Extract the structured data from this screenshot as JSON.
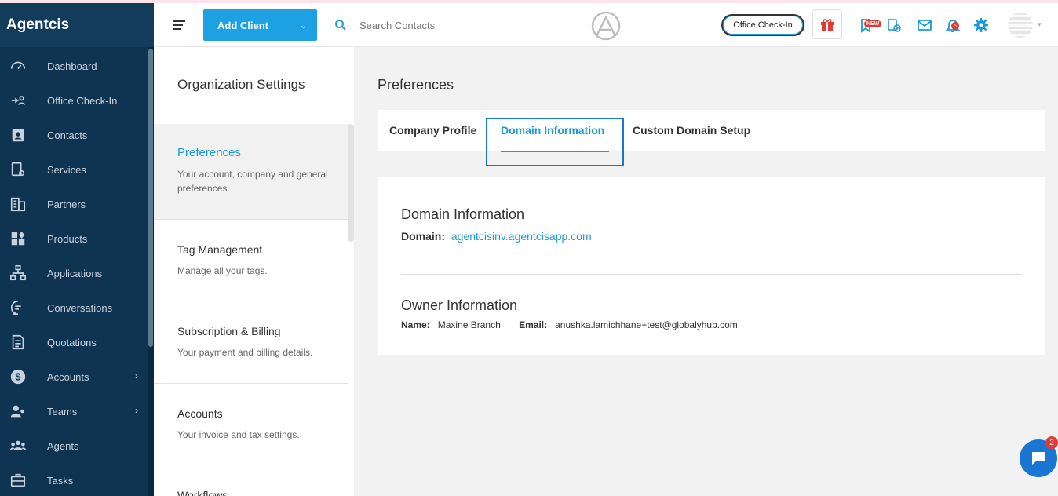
{
  "sidebar": {
    "brand": "Agentcis",
    "items": [
      {
        "label": "Dashboard",
        "icon": "dashboard-icon"
      },
      {
        "label": "Office Check-In",
        "icon": "office-checkin-icon"
      },
      {
        "label": "Contacts",
        "icon": "contacts-icon"
      },
      {
        "label": "Services",
        "icon": "services-icon"
      },
      {
        "label": "Partners",
        "icon": "partners-icon"
      },
      {
        "label": "Products",
        "icon": "products-icon"
      },
      {
        "label": "Applications",
        "icon": "applications-icon"
      },
      {
        "label": "Conversations",
        "icon": "conversations-icon"
      },
      {
        "label": "Quotations",
        "icon": "quotations-icon"
      },
      {
        "label": "Accounts",
        "icon": "accounts-icon",
        "has_submenu": true
      },
      {
        "label": "Teams",
        "icon": "teams-icon",
        "has_submenu": true
      },
      {
        "label": "Agents",
        "icon": "agents-icon"
      },
      {
        "label": "Tasks",
        "icon": "tasks-icon"
      }
    ]
  },
  "header": {
    "add_client_label": "Add Client",
    "search_placeholder": "Search Contacts",
    "office_checkin_label": "Office Check-In",
    "new_badge": "NEW",
    "notification_count": "5"
  },
  "settings_menu": {
    "title": "Organization Settings",
    "items": [
      {
        "title": "Preferences",
        "desc": "Your account, company and general preferences.",
        "active": true
      },
      {
        "title": "Tag Management",
        "desc": "Manage all your tags."
      },
      {
        "title": "Subscription & Billing",
        "desc": "Your payment and billing details."
      },
      {
        "title": "Accounts",
        "desc": "Your invoice and tax settings."
      },
      {
        "title": "Workflows",
        "desc": ""
      }
    ]
  },
  "main": {
    "title": "Preferences",
    "tabs": [
      {
        "label": "Company Profile"
      },
      {
        "label": "Domain Information",
        "active": true
      },
      {
        "label": "Custom Domain Setup"
      }
    ],
    "domain": {
      "title": "Domain Information",
      "label": "Domain:",
      "value": "agentcisinv.agentcisapp.com"
    },
    "owner": {
      "title": "Owner Information",
      "name_label": "Name:",
      "name": "Maxine Branch",
      "email_label": "Email:",
      "email": "anushka.lamichhane+test@globalyhub.com"
    }
  },
  "chat": {
    "unread": "2"
  },
  "colors": {
    "accent": "#1a9ad6",
    "sidebar": "#0f3452",
    "button": "#1da1e2"
  }
}
